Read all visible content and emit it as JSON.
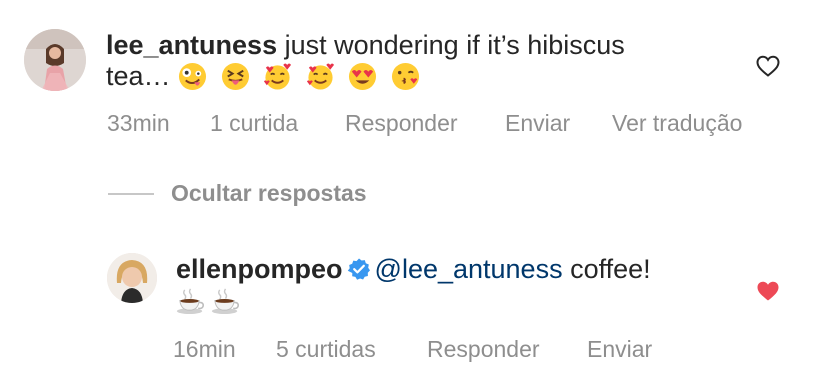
{
  "comments": [
    {
      "username": "lee_antuness",
      "text_line1": " just wondering if it’s hibiscus",
      "text_line2": "tea… ",
      "emojis": [
        "zany-face",
        "squinting-tongue-face",
        "smiling-face-with-hearts",
        "smiling-face-with-hearts",
        "heart-eyes-face",
        "face-blowing-kiss"
      ],
      "time": "33min",
      "likes": "1 curtida",
      "reply_label": "Responder",
      "send_label": "Enviar",
      "translate_label": "Ver tradução",
      "liked": false
    },
    {
      "username": "ellenpompeo",
      "verified": true,
      "mention": "@lee_antuness",
      "text": " coffee!",
      "emojis": [
        "hot-beverage",
        "hot-beverage"
      ],
      "time": "16min",
      "likes": "5 curtidas",
      "reply_label": "Responder",
      "send_label": "Enviar",
      "liked": true
    }
  ],
  "replies_toggle": {
    "label": "Ocultar respostas"
  },
  "colors": {
    "text": "#262626",
    "muted": "#8e8e8e",
    "mention": "#00376b",
    "verified": "#3897f0",
    "liked_heart": "#ed4956"
  }
}
